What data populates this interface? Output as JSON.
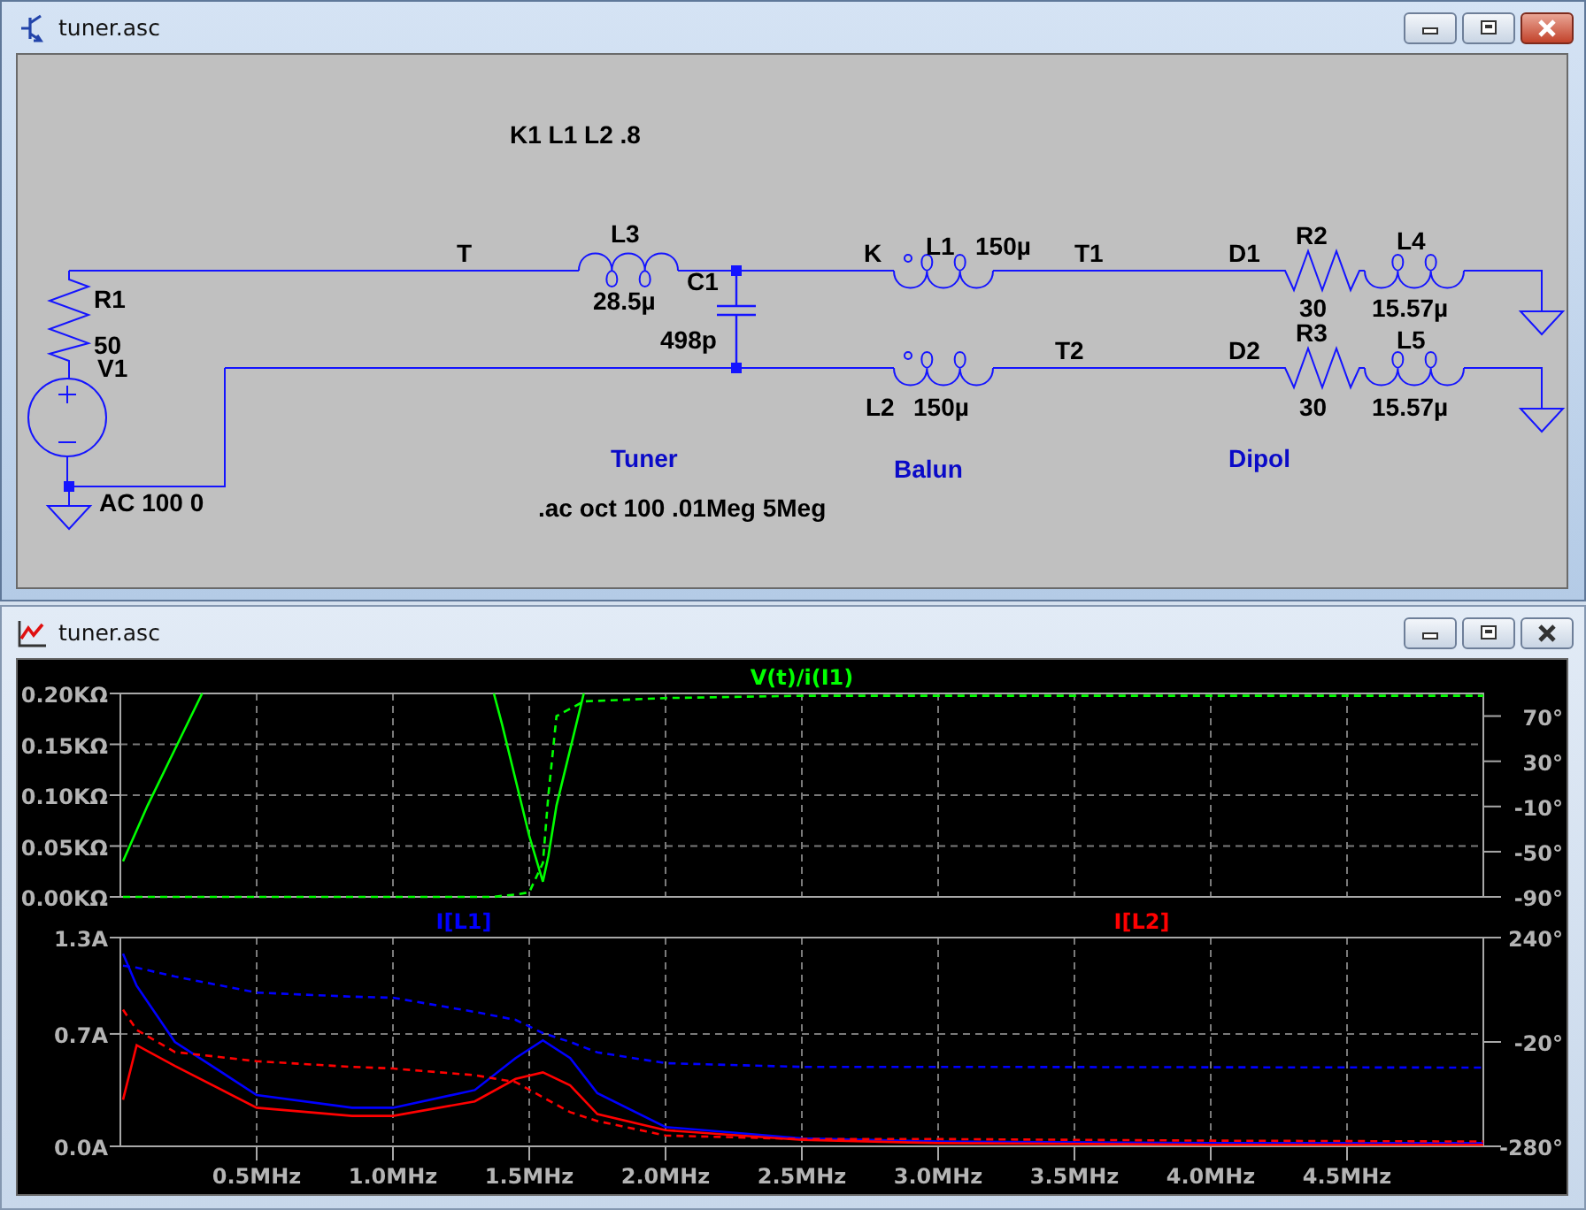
{
  "schematic_window": {
    "title": "tuner.asc",
    "active": true,
    "schematic": {
      "directives": [
        "K1 L1 L2 .8",
        ".ac oct 100 .01Meg 5Meg"
      ],
      "net_labels": [
        "T",
        "K",
        "T1",
        "D1",
        "T2",
        "D2"
      ],
      "block_labels": [
        "Tuner",
        "Balun",
        "Dipol"
      ],
      "components": [
        {
          "kind": "resistor",
          "name": "R1",
          "value": "50"
        },
        {
          "kind": "voltage_source",
          "name": "V1",
          "value": "AC 100 0"
        },
        {
          "kind": "inductor",
          "name": "L3",
          "value": "28.5µ"
        },
        {
          "kind": "capacitor",
          "name": "C1",
          "value": "498p"
        },
        {
          "kind": "inductor",
          "name": "L1",
          "value": "150µ"
        },
        {
          "kind": "inductor",
          "name": "L2",
          "value": "150µ"
        },
        {
          "kind": "resistor",
          "name": "R2",
          "value": "30"
        },
        {
          "kind": "inductor",
          "name": "L4",
          "value": "15.57µ"
        },
        {
          "kind": "resistor",
          "name": "R3",
          "value": "30"
        },
        {
          "kind": "inductor",
          "name": "L5",
          "value": "15.57µ"
        }
      ]
    }
  },
  "plot_window": {
    "title": "tuner.asc",
    "active": false,
    "panes": [
      {
        "chart_data": {
          "type": "line",
          "grid": true,
          "xlim": [
            0,
            5
          ],
          "ylim": [
            0,
            0.2
          ],
          "y2lim": [
            -90,
            90
          ],
          "yticks": [
            {
              "value": 0,
              "label": "0.00KΩ"
            },
            {
              "value": 0.05,
              "label": "0.05KΩ"
            },
            {
              "value": 0.1,
              "label": "0.10KΩ"
            },
            {
              "value": 0.15,
              "label": "0.15KΩ"
            },
            {
              "value": 0.2,
              "label": "0.20KΩ"
            }
          ],
          "y2ticks": [
            {
              "value": 70,
              "label": "70°"
            },
            {
              "value": 30,
              "label": "30°"
            },
            {
              "value": -10,
              "label": "-10°"
            },
            {
              "value": -50,
              "label": "-50°"
            },
            {
              "value": -90,
              "label": "-90°"
            }
          ],
          "x": [
            0.01,
            0.1,
            0.2,
            0.3,
            0.8,
            1.37,
            1.4,
            1.45,
            1.5,
            1.55,
            1.57,
            1.6,
            1.7,
            2.0,
            2.5,
            3.0,
            4.0,
            5.0
          ],
          "series": [
            {
              "name": "V(t)/i(I1)",
              "color": "#00ff00",
              "values": [
                0.035,
                0.09,
                0.145,
                0.2,
                null,
                0.2,
                0.17,
                0.115,
                0.06,
                0.015,
                0.04,
                0.09,
                0.2,
                null,
                null,
                null,
                null,
                null
              ]
            },
            {
              "color": "#00ff00",
              "axis": "y2",
              "line_style": "dashed",
              "values": [
                -90,
                -90,
                -90,
                -90,
                -90,
                -90,
                -89,
                -88,
                -86,
                -60,
                0,
                70,
                83,
                86,
                88,
                88,
                88,
                88
              ]
            }
          ]
        }
      },
      {
        "chart_data": {
          "type": "line",
          "grid": true,
          "xlim": [
            0,
            5
          ],
          "ylim": [
            0,
            1.3
          ],
          "y2lim": [
            -280,
            240
          ],
          "xticks": [
            {
              "value": 0.5,
              "label": "0.5MHz"
            },
            {
              "value": 1,
              "label": "1.0MHz"
            },
            {
              "value": 1.5,
              "label": "1.5MHz"
            },
            {
              "value": 2,
              "label": "2.0MHz"
            },
            {
              "value": 2.5,
              "label": "2.5MHz"
            },
            {
              "value": 3,
              "label": "3.0MHz"
            },
            {
              "value": 3.5,
              "label": "3.5MHz"
            },
            {
              "value": 4,
              "label": "4.0MHz"
            },
            {
              "value": 4.5,
              "label": "4.5MHz"
            }
          ],
          "yticks": [
            {
              "value": 0,
              "label": "0.0A"
            },
            {
              "value": 0.7,
              "label": "0.7A"
            },
            {
              "value": 1.3,
              "label": "1.3A"
            }
          ],
          "y2ticks": [
            {
              "value": 240,
              "label": "240°"
            },
            {
              "value": -20,
              "label": "-20°"
            },
            {
              "value": -280,
              "label": "-280°"
            }
          ],
          "x": [
            0.01,
            0.06,
            0.2,
            0.5,
            0.85,
            1.0,
            1.3,
            1.45,
            1.55,
            1.65,
            1.75,
            2.0,
            2.5,
            3.0,
            4.0,
            5.0
          ],
          "series": [
            {
              "name": "I[L1]",
              "color": "#0000ff",
              "values": [
                1.2,
                1.0,
                0.65,
                0.32,
                0.24,
                0.24,
                0.35,
                0.55,
                0.66,
                0.55,
                0.33,
                0.12,
                0.05,
                0.03,
                0.02,
                0.02
              ]
            },
            {
              "color": "#0000ff",
              "axis": "y2",
              "line_style": "dashed",
              "values": [
                170,
                165,
                143,
                103,
                93,
                90,
                55,
                35,
                2,
                -20,
                -46,
                -73,
                -82,
                -82,
                -83,
                -84
              ]
            },
            {
              "name": "I[L2]",
              "color": "#ff0000",
              "values": [
                0.29,
                0.63,
                0.5,
                0.24,
                0.19,
                0.19,
                0.28,
                0.42,
                0.46,
                0.38,
                0.2,
                0.1,
                0.04,
                0.02,
                0.01,
                0.01
              ]
            },
            {
              "color": "#ff0000",
              "axis": "y2",
              "line_style": "dashed",
              "values": [
                60,
                10,
                -45,
                -68,
                -82,
                -86,
                -103,
                -120,
                -158,
                -195,
                -217,
                -253,
                -262,
                -262,
                -266,
                -268
              ]
            }
          ]
        }
      }
    ]
  }
}
